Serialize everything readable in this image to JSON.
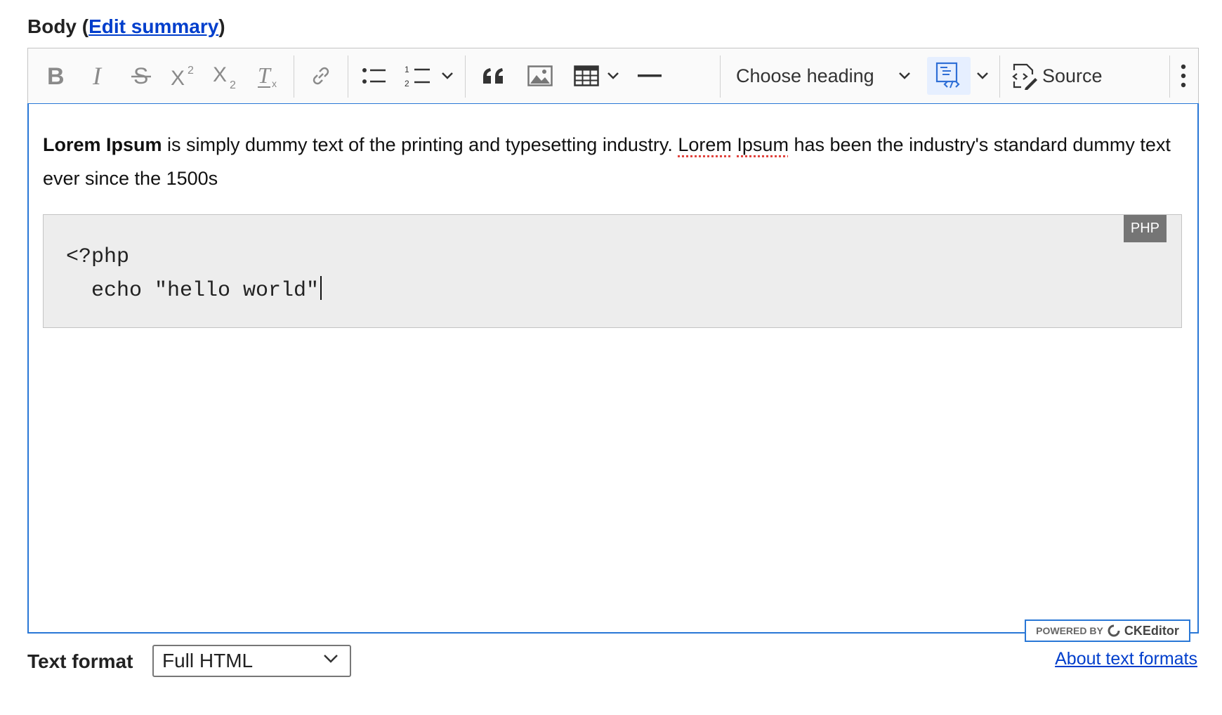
{
  "field": {
    "label": "Body",
    "open_paren": "(",
    "edit_summary": "Edit summary",
    "close_paren": ")"
  },
  "toolbar": {
    "heading_label": "Choose heading",
    "source_label": "Source",
    "icons": [
      "bold-icon",
      "italic-icon",
      "strikethrough-icon",
      "superscript-icon",
      "subscript-icon",
      "remove-format-icon",
      "link-icon",
      "bulleted-list-icon",
      "numbered-list-icon",
      "block-quote-icon",
      "image-icon",
      "table-icon",
      "horizontal-line-icon",
      "code-block-icon",
      "source-icon",
      "more-icon"
    ],
    "active_color": "#e6efff"
  },
  "content": {
    "para_bold": "Lorem Ipsum",
    "para_text1": " is simply dummy text of the printing and typesetting industry. ",
    "para_spell1": "Lorem",
    "para_space": " ",
    "para_spell2": "Ipsum",
    "para_text2": " has been the industry's standard dummy text ever since the 1500s",
    "code_language": "PHP",
    "code_line1": "<?php",
    "code_line2": "  echo \"hello world\""
  },
  "powered_by": {
    "label": "POWERED BY",
    "brand": "CKEditor"
  },
  "text_format": {
    "label": "Text format",
    "value": "Full HTML",
    "about": "About text formats"
  },
  "colors": {
    "link": "#003ecc",
    "focus_border": "#2977d6",
    "code_bg": "#ededed",
    "lang_badge": "#757575"
  }
}
